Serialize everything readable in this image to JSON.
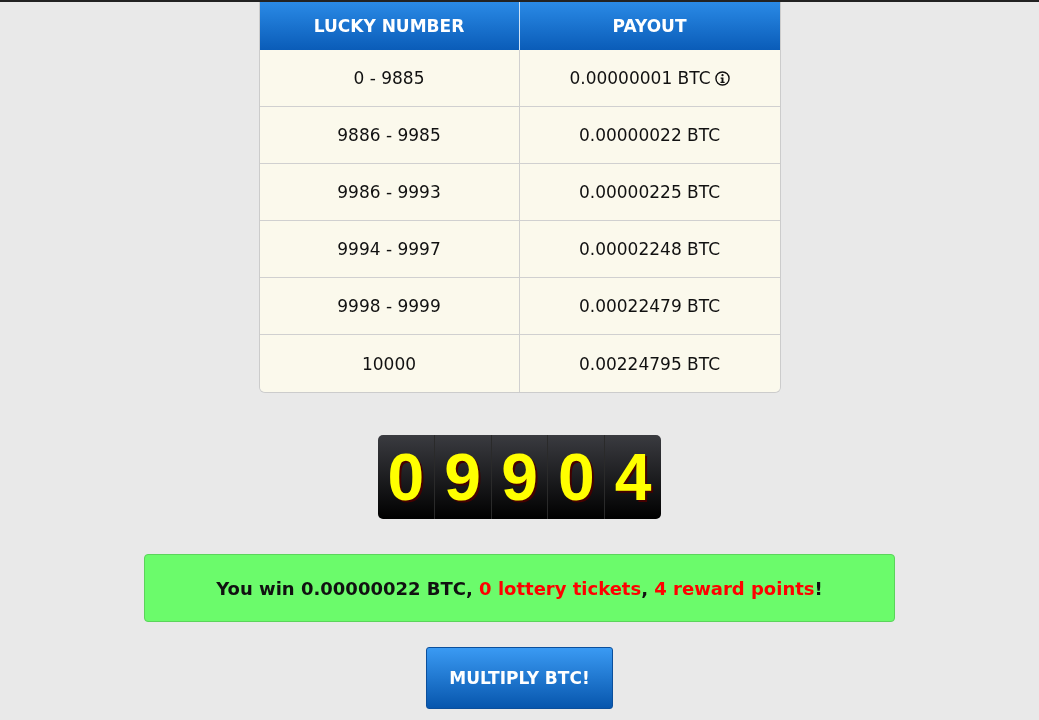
{
  "table": {
    "columns": [
      "LUCKY NUMBER",
      "PAYOUT"
    ],
    "rows": [
      {
        "range": "0 - 9885",
        "payout": "0.00000001 BTC",
        "info": true
      },
      {
        "range": "9886 - 9985",
        "payout": "0.00000022 BTC",
        "info": false
      },
      {
        "range": "9986 - 9993",
        "payout": "0.00000225 BTC",
        "info": false
      },
      {
        "range": "9994 - 9997",
        "payout": "0.00002248 BTC",
        "info": false
      },
      {
        "range": "9998 - 9999",
        "payout": "0.00022479 BTC",
        "info": false
      },
      {
        "range": "10000",
        "payout": "0.00224795 BTC",
        "info": false
      }
    ]
  },
  "counter": [
    "0",
    "9",
    "9",
    "0",
    "4"
  ],
  "result": [
    {
      "text": "You win 0.00000022 BTC, ",
      "highlight": false
    },
    {
      "text": "0 lottery tickets",
      "highlight": true
    },
    {
      "text": ", ",
      "highlight": false
    },
    {
      "text": "4 reward points",
      "highlight": true
    },
    {
      "text": "!",
      "highlight": false
    }
  ],
  "button": "MULTIPLY BTC!"
}
